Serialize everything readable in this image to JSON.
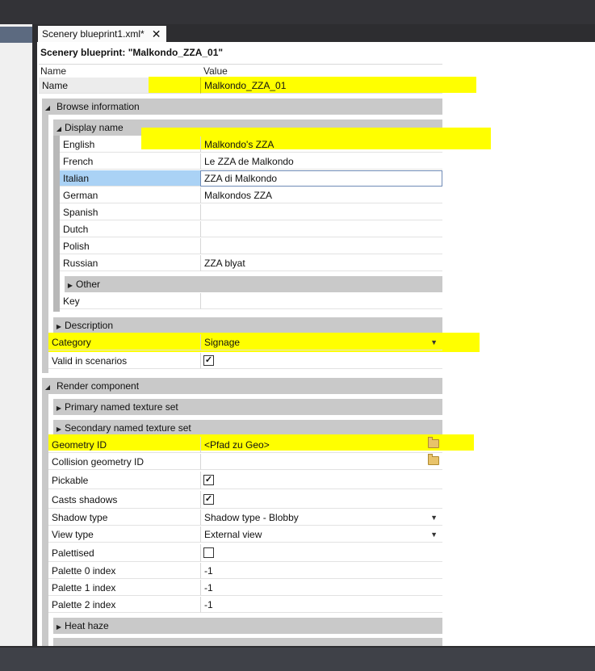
{
  "window": {
    "tab_title": "Scenery blueprint1.xml*",
    "close_glyph": "✕",
    "blueprint_title": "Scenery blueprint: \"Malkondo_ZZA_01\""
  },
  "headers": {
    "name": "Name",
    "value": "Value"
  },
  "name_row": {
    "label": "Name",
    "value": "Malkondo_ZZA_01"
  },
  "browse_information": {
    "label": "Browse information",
    "display_name": {
      "label": "Display name",
      "rows": [
        {
          "label": "English",
          "value": "Malkondo's ZZA"
        },
        {
          "label": "French",
          "value": "Le ZZA de Malkondo"
        },
        {
          "label": "Italian",
          "value": "ZZA di Malkondo"
        },
        {
          "label": "German",
          "value": "Malkondos ZZA"
        },
        {
          "label": "Spanish",
          "value": ""
        },
        {
          "label": "Dutch",
          "value": ""
        },
        {
          "label": "Polish",
          "value": ""
        },
        {
          "label": "Russian",
          "value": "ZZA blyat"
        }
      ],
      "other_label": "Other",
      "key_label": "Key"
    },
    "description_label": "Description",
    "category": {
      "label": "Category",
      "value": "Signage"
    },
    "valid_in_scenarios": {
      "label": "Valid in scenarios",
      "checked": true
    }
  },
  "render_component": {
    "label": "Render component",
    "primary_texture": "Primary named texture set",
    "secondary_texture": "Secondary named texture set",
    "geometry_id": {
      "label": "Geometry ID",
      "value": "<Pfad zu Geo>"
    },
    "collision_geometry_id": {
      "label": "Collision geometry ID",
      "value": ""
    },
    "pickable": {
      "label": "Pickable",
      "checked": true
    },
    "casts_shadows": {
      "label": "Casts shadows",
      "checked": true
    },
    "shadow_type": {
      "label": "Shadow type",
      "value": "Shadow type - Blobby"
    },
    "view_type": {
      "label": "View type",
      "value": "External view"
    },
    "palettised": {
      "label": "Palettised",
      "checked": false
    },
    "palette_0": {
      "label": "Palette 0 index",
      "value": "-1"
    },
    "palette_1": {
      "label": "Palette 1 index",
      "value": "-1"
    },
    "palette_2": {
      "label": "Palette 2 index",
      "value": "-1"
    },
    "heat_haze": "Heat haze"
  },
  "glyphs": {
    "check": "✓",
    "expanded": "◢",
    "collapsed": "▶",
    "dropdown": "▼"
  },
  "colors": {
    "highlight": "#ffff00",
    "selection": "#aad2f5",
    "group_bar": "#c9c9c9"
  }
}
